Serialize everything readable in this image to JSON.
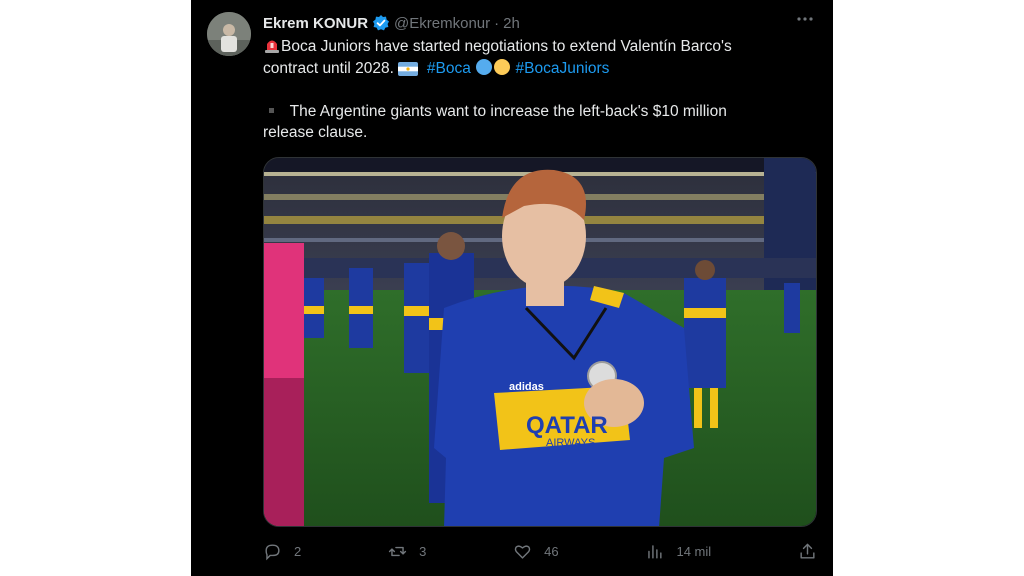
{
  "tweet": {
    "author_name": "Ekrem KONUR",
    "handle": "@Ekremkonur",
    "separator": "·",
    "timestamp": "2h",
    "line1": "Boca Juniors have started negotiations to extend Valentín Barco's",
    "line2_text": "contract until 2028.",
    "hashtag1": "#Boca",
    "hashtag2": "#BocaJuniors",
    "line3": "The Argentine giants want to increase the left-back's $10 million",
    "line4": "release clause."
  },
  "media": {
    "sponsor_text": "QATAR",
    "sponsor_subtext": "AIRWAYS",
    "brand_text": "adidas"
  },
  "actions": {
    "replies": "2",
    "reposts": "3",
    "likes": "46",
    "views": "14 mil"
  },
  "colors": {
    "background": "#000000",
    "text": "#e7e9ea",
    "muted": "#71767b",
    "link": "#1d9bf0",
    "verified": "#1d9bf0"
  }
}
